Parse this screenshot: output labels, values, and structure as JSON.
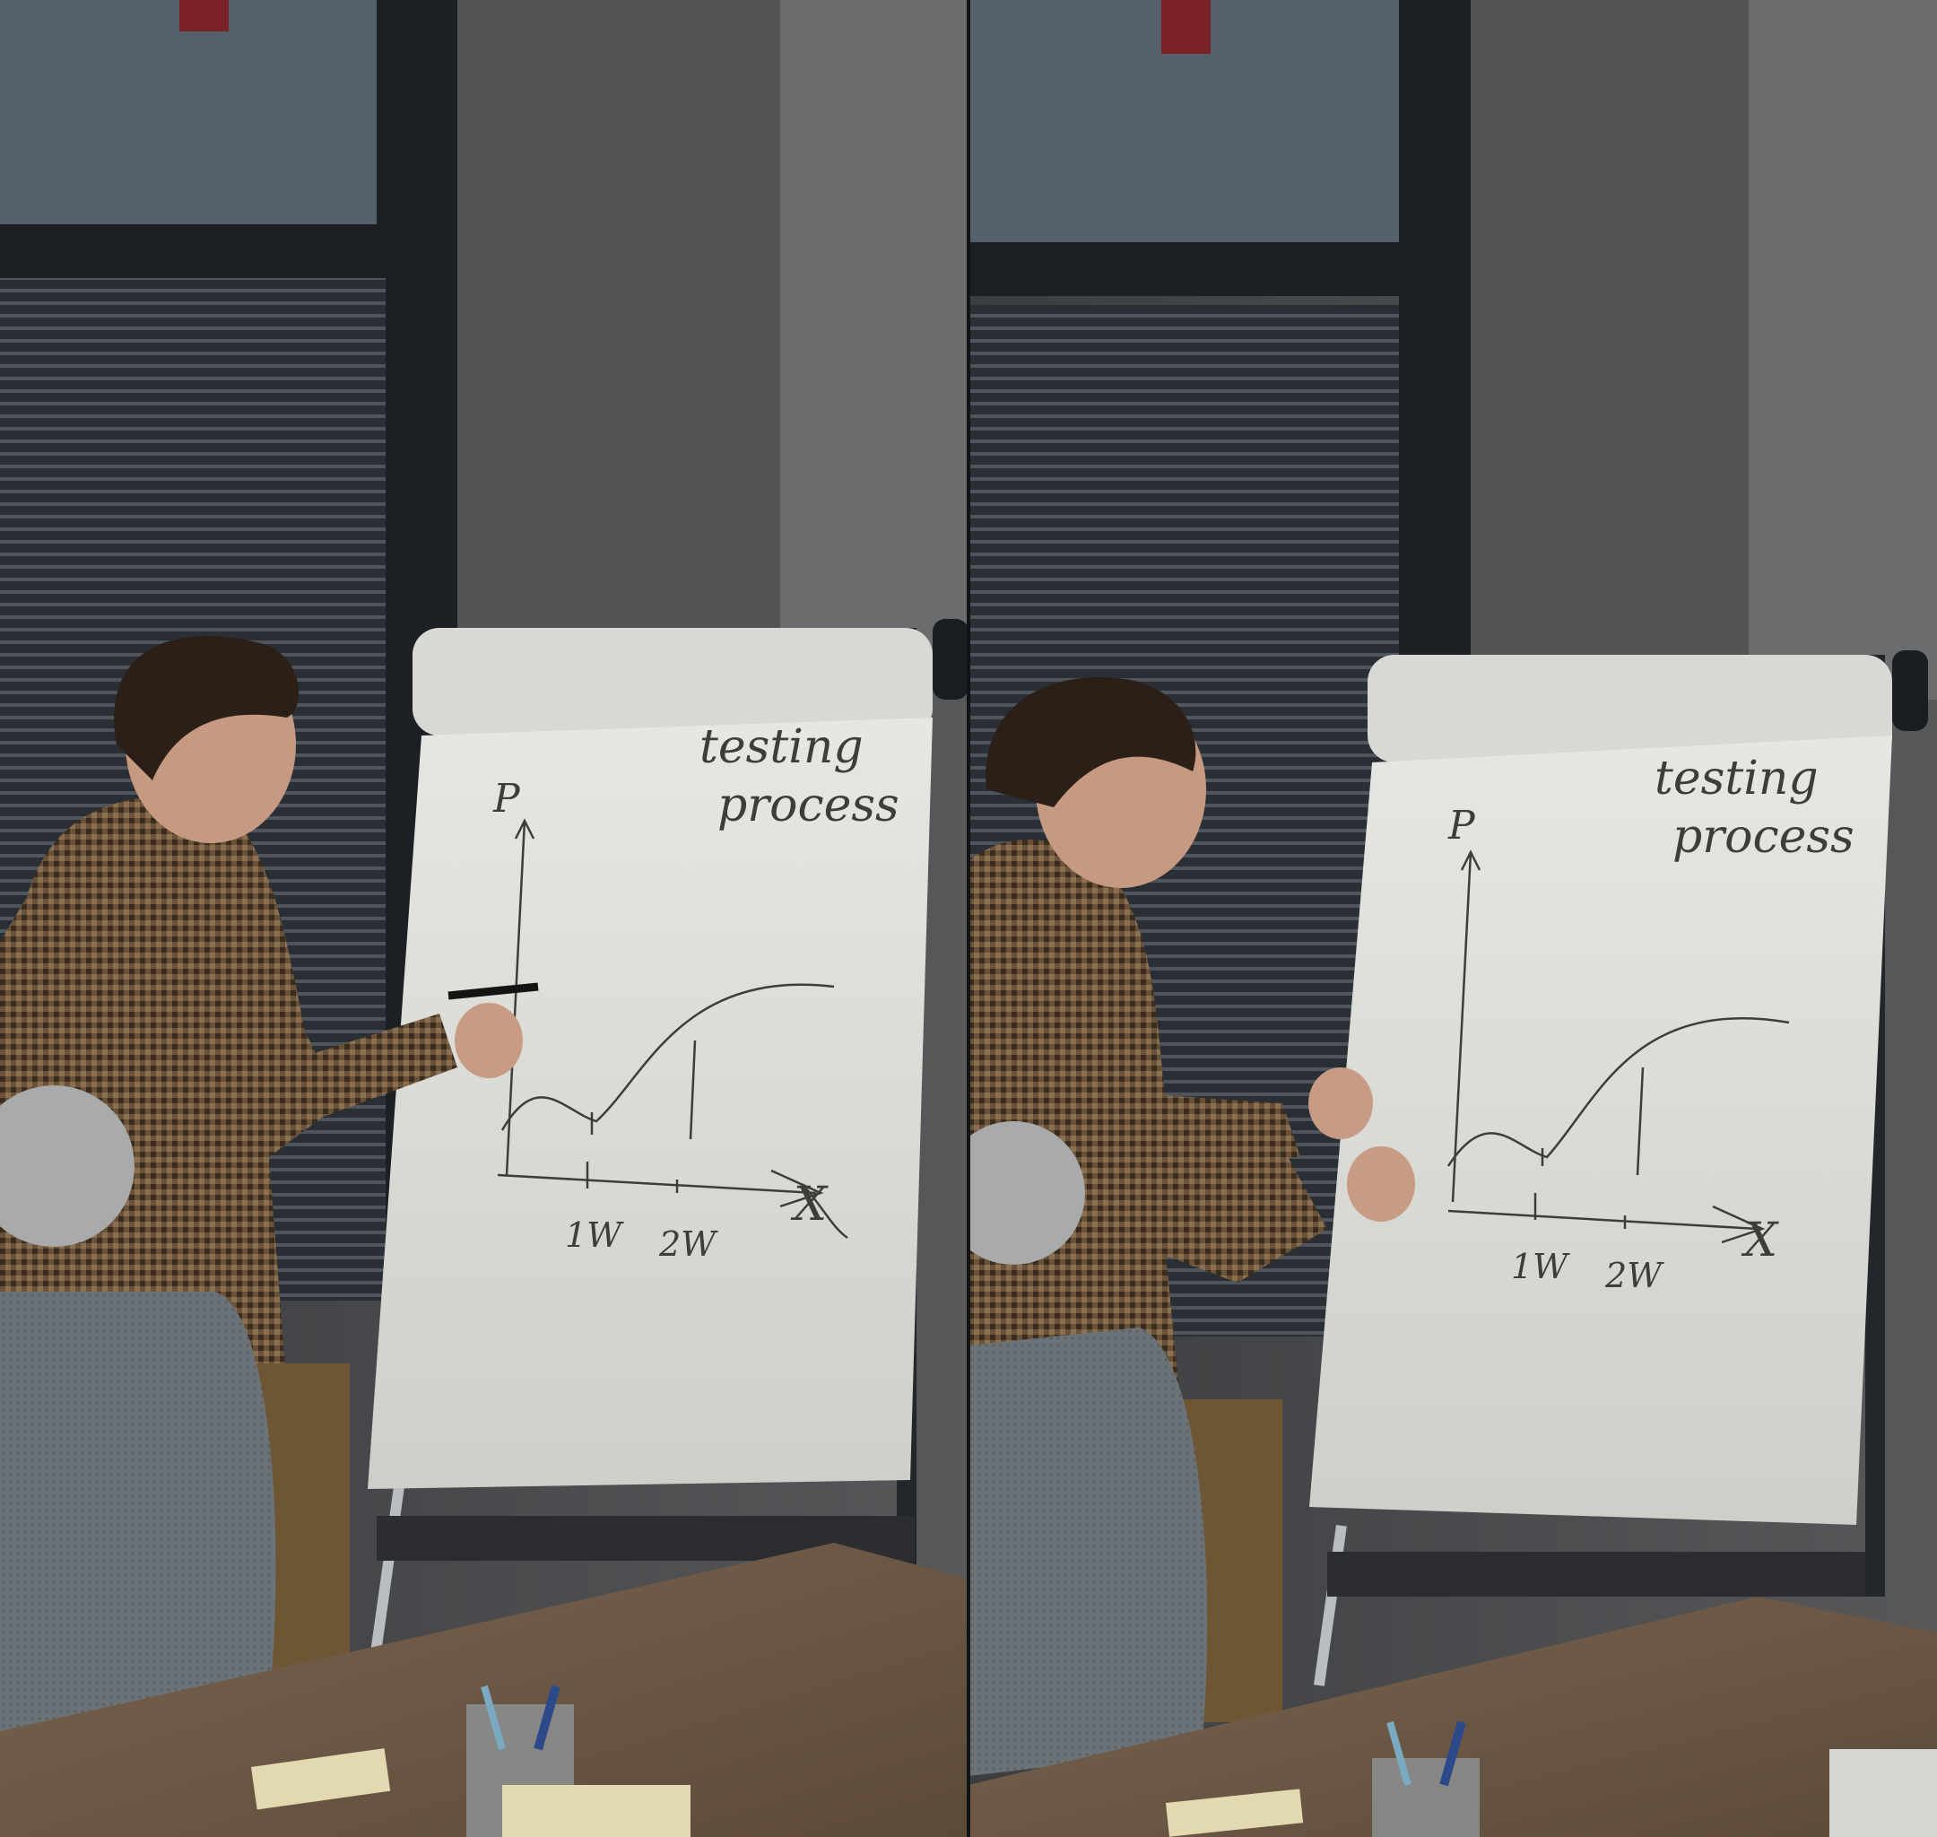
{
  "panels": [
    {
      "id": "left",
      "flipchart": {
        "heading_line1": "testing",
        "heading_line2": "process",
        "y_axis_label": "P",
        "x_tick_1": "1W",
        "x_tick_2": "2W",
        "x_axis_end_mark": "X"
      }
    },
    {
      "id": "right",
      "flipchart": {
        "heading_line1": "testing",
        "heading_line2": "process",
        "y_axis_label": "P",
        "x_tick_1": "1W",
        "x_tick_2": "2W",
        "x_axis_end_mark": "X"
      }
    }
  ],
  "colors": {
    "wall": "#4a4b4c",
    "window_dark": "#22262b",
    "paper": "#dcdcd8",
    "shirt": "#5a4632",
    "table": "#6e5a46",
    "ink": "#3f3d3a"
  }
}
